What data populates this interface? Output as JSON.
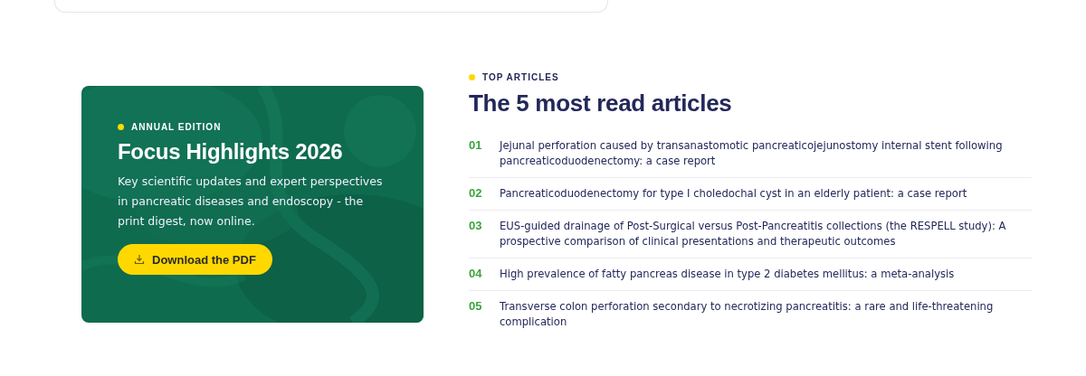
{
  "promo": {
    "eyebrow": "ANNUAL EDITION",
    "title": "Focus Highlights 2026",
    "description": "Key scientific updates and expert perspectives in pancreatic diseases and endoscopy - the print digest, now online.",
    "button": "Download the PDF"
  },
  "top_articles": {
    "eyebrow": "TOP ARTICLES",
    "title": "The 5 most read articles",
    "items": [
      {
        "rank": "01",
        "title": "Jejunal perforation caused by transanastomotic pancreaticojejunostomy internal stent following pancreaticoduodenectomy: a case report"
      },
      {
        "rank": "02",
        "title": "Pancreaticoduodenectomy for type I choledochal cyst in an elderly patient: a case report"
      },
      {
        "rank": "03",
        "title": "EUS-guided drainage of Post-Surgical versus Post-Pancreatitis collections (the RESPELL study): A prospective comparison of clinical presentations and therapeutic outcomes"
      },
      {
        "rank": "04",
        "title": "High prevalence of fatty pancreas disease in type 2 diabetes mellitus: a meta-analysis"
      },
      {
        "rank": "05",
        "title": "Transverse colon perforation secondary to necrotizing pancreatitis: a rare and life-threatening complication"
      }
    ]
  }
}
